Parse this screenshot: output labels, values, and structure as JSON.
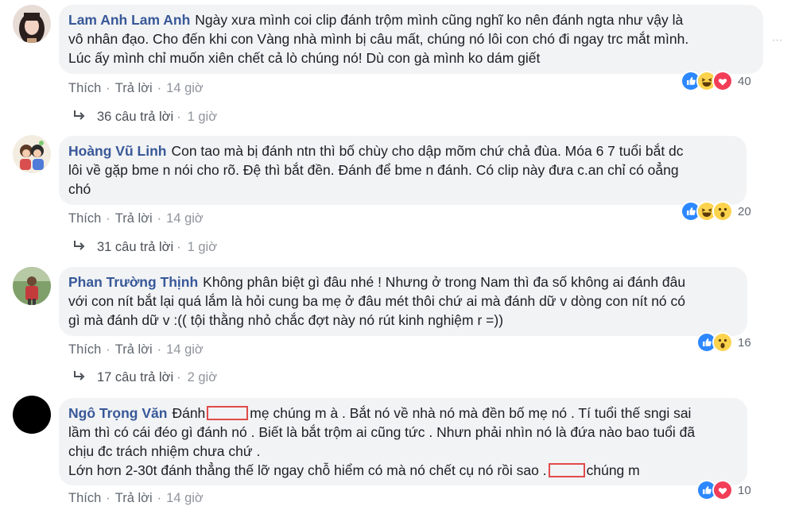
{
  "comments": [
    {
      "author": "Lam Anh Lam Anh",
      "line1": "Ngày xưa mình coi clip đánh trộm mình cũng nghĩ ko nên đánh ngta như vậy là",
      "line2": "vô nhân đạo. Cho đến khi con Vàng nhà mình bị câu mất, chúng nó lôi con chó đi ngay trc mắt mình.",
      "line3": "Lúc ấy mình chỉ muốn xiên chết cả lò chúng nó! Dù con gà mình ko dám giết",
      "like_label": "Thích",
      "reply_label": "Trả lời",
      "time": "14 giờ",
      "reaction_count": "40",
      "reactions": [
        "like-icon",
        "haha-icon",
        "love-icon"
      ],
      "replies_text": "36 câu trả lời",
      "replies_time": "1 giờ"
    },
    {
      "author": "Hoàng Vũ Linh",
      "line1": "Con tao mà bị đánh ntn thì bố chùy cho dập mõm chứ chả đùa. Móa 6 7 tuổi bắt dc",
      "line2": "lôi về gặp bme n nói cho rõ. Đệ thì bắt đền. Đánh để bme n đánh. Có clip này đưa c.an chỉ có oẳng",
      "line3": "chó",
      "like_label": "Thích",
      "reply_label": "Trả lời",
      "time": "14 giờ",
      "reaction_count": "20",
      "reactions": [
        "like-icon",
        "haha-icon",
        "wow-icon"
      ],
      "replies_text": "31 câu trả lời",
      "replies_time": "1 giờ"
    },
    {
      "author": "Phan Trường Thịnh",
      "line1": "Không phân biệt gì đâu nhé ! Nhưng ở trong Nam thì đa số không ai đánh đâu",
      "line2": "với con nít bắt lại quá lắm là hỏi cung ba mẹ ở đâu mét thôi chứ ai mà đánh dữ v dòng con nít nó có",
      "line3": "gì mà đánh dữ v :(( tội thằng nhỏ chắc đợt này nó rút kinh nghiệm r =))",
      "like_label": "Thích",
      "reply_label": "Trả lời",
      "time": "14 giờ",
      "reaction_count": "16",
      "reactions": [
        "like-icon",
        "wow-icon"
      ],
      "replies_text": "17 câu trả lời",
      "replies_time": "2 giờ"
    },
    {
      "author": "Ngô Trọng Văn",
      "line1a": "Đánh",
      "line1b": "mẹ chúng m à . Bắt nó về nhà nó mà đền bố mẹ nó . Tí tuổi thế sngi sai",
      "line2": "lầm thì có cái đéo gì đánh nó . Biết là bắt trộm ai cũng tức . Nhưn phải nhìn nó là đứa nào bao tuổi đã",
      "line3": "chịu đc trách nhiệm chưa chứ .",
      "line4a": "Lớn hơn 2-30t đánh thẳng thế lỡ ngay chỗ hiểm có mà nó chết cụ nó rồi sao .",
      "line4b": "chúng m",
      "like_label": "Thích",
      "reply_label": "Trả lời",
      "time": "14 giờ",
      "reaction_count": "10",
      "reactions": [
        "like-icon",
        "love-icon"
      ]
    }
  ],
  "colors": {
    "author": "#385898",
    "bubble": "#f2f3f5",
    "like_blue": "#2d88ff",
    "love_red": "#f33e58",
    "haha_yellow": "#fcd34d",
    "redaction": "#e04b4b"
  }
}
